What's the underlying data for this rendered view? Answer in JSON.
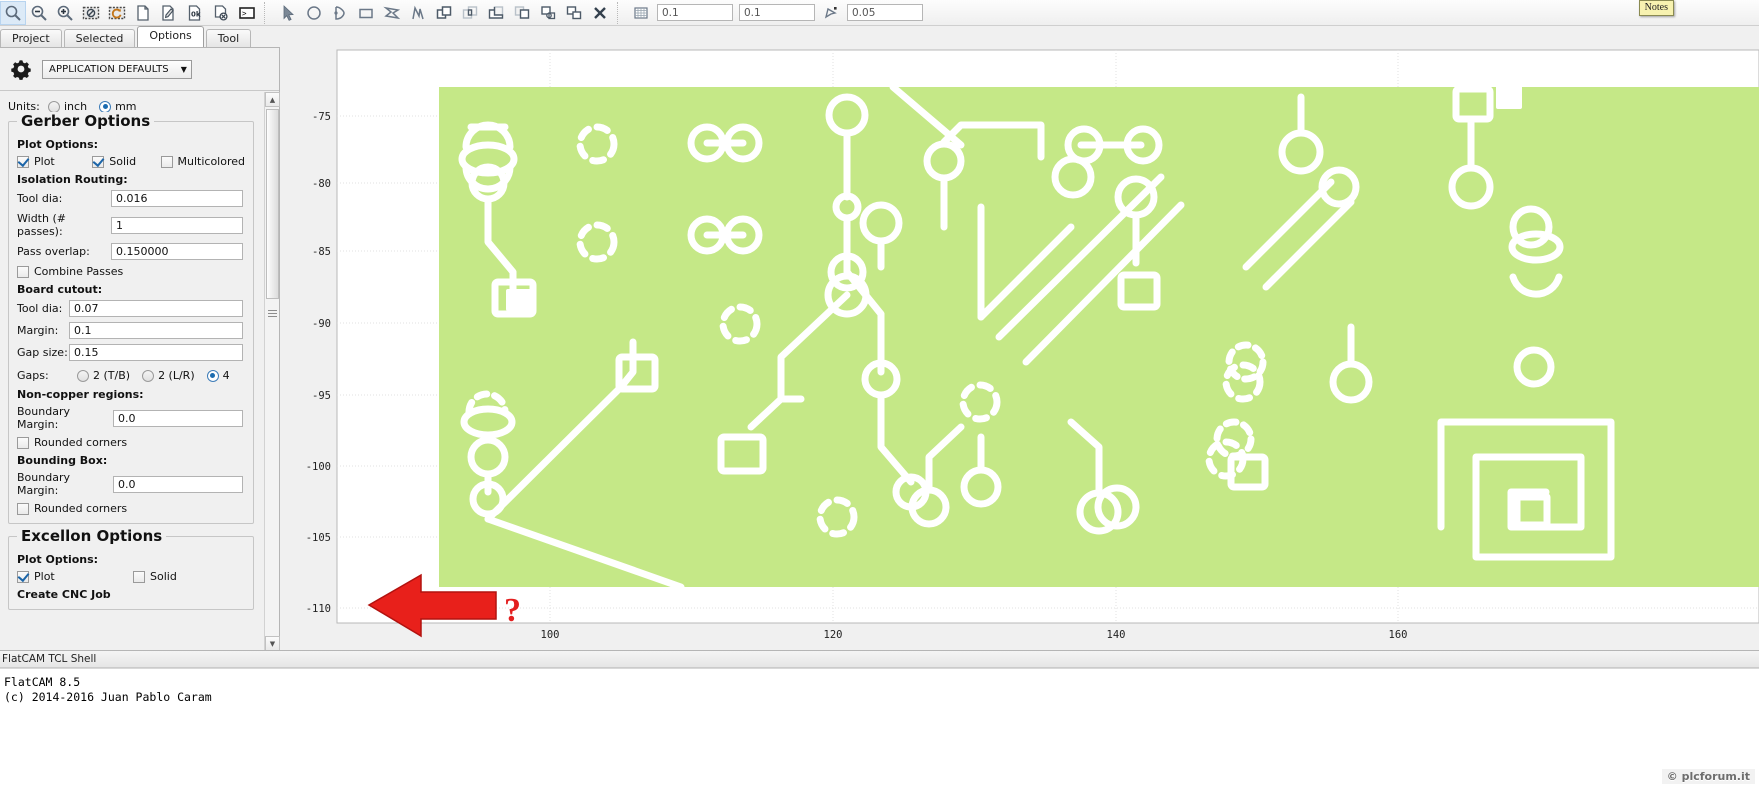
{
  "app": {
    "title": "FlatCAM",
    "version_line": "FlatCAM 8.5",
    "copyright_line": "(c) 2014-2016 Juan Pablo Caram"
  },
  "watermark": {
    "text": "© plcforum.it"
  },
  "toolbar": {
    "notes_label": "Notes",
    "icons": [
      {
        "name": "zoom-fit-icon",
        "glyph": "zoom"
      },
      {
        "name": "zoom-out-icon",
        "glyph": "zoom-minus"
      },
      {
        "name": "zoom-in-icon",
        "glyph": "zoom-plus"
      },
      {
        "name": "clear-plot-icon",
        "glyph": "frame-slash"
      },
      {
        "name": "replot-icon",
        "glyph": "frame-refresh"
      },
      {
        "name": "new-project-icon",
        "glyph": "page"
      },
      {
        "name": "open-gerber-icon",
        "glyph": "page-pen"
      },
      {
        "name": "open-excellon-icon",
        "glyph": "page-ok"
      },
      {
        "name": "open-gcode-icon",
        "glyph": "page-x"
      },
      {
        "name": "shell-icon",
        "glyph": "terminal"
      },
      {
        "name": "select-tool-icon",
        "glyph": "cursor"
      },
      {
        "name": "circle-tool-icon",
        "glyph": "circle"
      },
      {
        "name": "arc-tool-icon",
        "glyph": "arc"
      },
      {
        "name": "rectangle-tool-icon",
        "glyph": "rect"
      },
      {
        "name": "polygon-tool-icon",
        "glyph": "polygon"
      },
      {
        "name": "path-tool-icon",
        "glyph": "path"
      },
      {
        "name": "union-icon",
        "glyph": "shape-union"
      },
      {
        "name": "intersection-icon",
        "glyph": "shape-intersect"
      },
      {
        "name": "subtract-icon",
        "glyph": "shape-subtract"
      },
      {
        "name": "cut-icon",
        "glyph": "shape-cut"
      },
      {
        "name": "copy-shape-icon",
        "glyph": "shape-copy"
      },
      {
        "name": "paste-shape-icon",
        "glyph": "shape-paste"
      },
      {
        "name": "delete-shape-icon",
        "glyph": "x-cross"
      },
      {
        "name": "snap-grid-icon",
        "glyph": "grid"
      }
    ],
    "grid_x": "0.1",
    "grid_y": "0.1",
    "snap_max_label": "snap-max-icon",
    "snap_max": "0.05"
  },
  "tabs": [
    {
      "label": "Project",
      "active": false
    },
    {
      "label": "Selected",
      "active": false
    },
    {
      "label": "Options",
      "active": true
    },
    {
      "label": "Tool",
      "active": false
    }
  ],
  "options_panel": {
    "gear_icon": "gear-icon",
    "scope_selector": {
      "value": "APPLICATION DEFAULTS",
      "caret": "▼"
    },
    "units": {
      "label": "Units:",
      "choices": [
        {
          "label": "inch",
          "selected": false
        },
        {
          "label": "mm",
          "selected": true
        }
      ]
    },
    "gerber": {
      "title": "Gerber Options",
      "plot_options_label": "Plot Options:",
      "plot_options": [
        {
          "label": "Plot",
          "checked": true
        },
        {
          "label": "Solid",
          "checked": true
        },
        {
          "label": "Multicolored",
          "checked": false
        }
      ],
      "isolation_label": "Isolation Routing:",
      "isolation_fields": [
        {
          "label": "Tool dia:",
          "value": "0.016"
        },
        {
          "label": "Width (# passes):",
          "value": "1"
        },
        {
          "label": "Pass overlap:",
          "value": "0.150000"
        }
      ],
      "combine_passes": {
        "label": "Combine Passes",
        "checked": false
      },
      "board_cutout_label": "Board cutout:",
      "board_cutout_fields": [
        {
          "label": "Tool dia:",
          "value": "0.07"
        },
        {
          "label": "Margin:",
          "value": "0.1"
        },
        {
          "label": "Gap size:",
          "value": "0.15"
        }
      ],
      "gaps": {
        "label": "Gaps:",
        "choices": [
          {
            "label": "2 (T/B)",
            "selected": false
          },
          {
            "label": "2 (L/R)",
            "selected": false
          },
          {
            "label": "4",
            "selected": true
          }
        ]
      },
      "noncopper_label": "Non-copper regions:",
      "noncopper_margin": {
        "label": "Boundary Margin:",
        "value": "0.0"
      },
      "noncopper_rounded": {
        "label": "Rounded corners",
        "checked": false
      },
      "bbox_label": "Bounding Box:",
      "bbox_margin": {
        "label": "Boundary Margin:",
        "value": "0.0"
      },
      "bbox_rounded": {
        "label": "Rounded corners",
        "checked": false
      }
    },
    "excellon": {
      "title": "Excellon Options",
      "plot_options_label": "Plot Options:",
      "plot_options": [
        {
          "label": "Plot",
          "checked": true
        },
        {
          "label": "Solid",
          "checked": false
        }
      ],
      "create_cnc_job_label": "Create CNC Job"
    }
  },
  "shell": {
    "tab_label": "FlatCAM TCL Shell"
  },
  "plot": {
    "y_ticks": [
      "-75",
      "-80",
      "-85",
      "-90",
      "-95",
      "-100",
      "-105",
      "-110"
    ],
    "x_ticks": [
      "100",
      "120",
      "140",
      "160"
    ],
    "annotation": "?",
    "board_fill": "#c5e887",
    "trace_color": "#ffffff",
    "grid_color": "#dddddd"
  },
  "colors": {
    "panel_bg": "#f0f0f0",
    "accent_blue": "#1d6cb0",
    "annotation_red": "#e31f1f",
    "board_green": "#c5e887"
  }
}
